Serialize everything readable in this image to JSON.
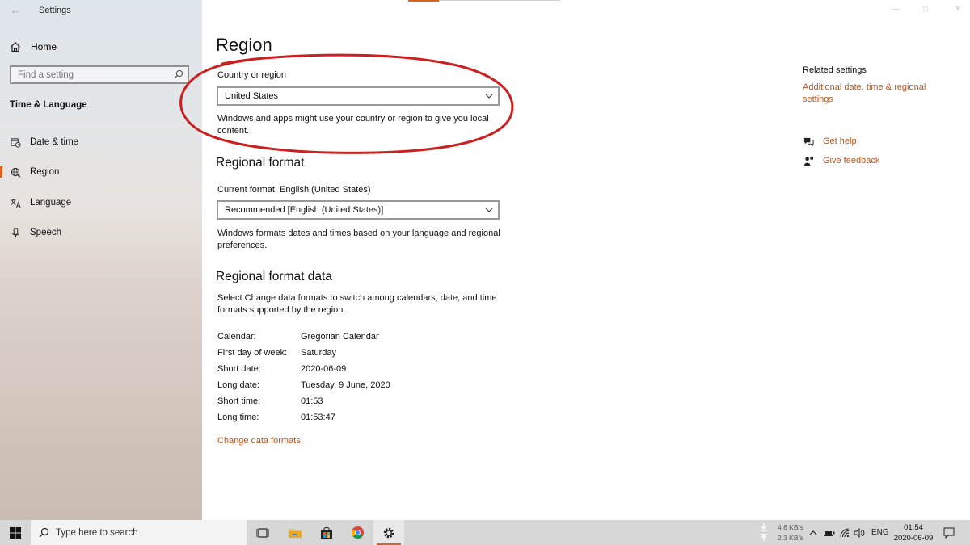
{
  "window": {
    "title": "Settings"
  },
  "sidebar": {
    "home_label": "Home",
    "search_placeholder": "Find a setting",
    "section_title": "Time & Language",
    "items": [
      {
        "label": "Date & time",
        "icon": "calendar-clock-icon",
        "active": false
      },
      {
        "label": "Region",
        "icon": "globe-icon",
        "active": true
      },
      {
        "label": "Language",
        "icon": "language-icon",
        "active": false
      },
      {
        "label": "Speech",
        "icon": "microphone-icon",
        "active": false
      }
    ]
  },
  "page": {
    "title": "Region",
    "country": {
      "label": "Country or region",
      "value": "United States",
      "description": "Windows and apps might use your country or region to give you local content."
    },
    "regional_format": {
      "heading": "Regional format",
      "current_label": "Current format: English (United States)",
      "value": "Recommended [English (United States)]",
      "description": "Windows formats dates and times based on your language and regional preferences."
    },
    "format_data": {
      "heading": "Regional format data",
      "description": "Select Change data formats to switch among calendars, date, and time formats supported by the region.",
      "rows": [
        {
          "key": "Calendar:",
          "value": "Gregorian Calendar"
        },
        {
          "key": "First day of week:",
          "value": "Saturday"
        },
        {
          "key": "Short date:",
          "value": "2020-06-09"
        },
        {
          "key": "Long date:",
          "value": "Tuesday, 9 June, 2020"
        },
        {
          "key": "Short time:",
          "value": "01:53"
        },
        {
          "key": "Long time:",
          "value": "01:53:47"
        }
      ],
      "change_link": "Change data formats"
    }
  },
  "related": {
    "title": "Related settings",
    "link": "Additional date, time & regional settings",
    "help": "Get help",
    "feedback": "Give feedback"
  },
  "taskbar": {
    "search_placeholder": "Type here to search",
    "net_down": "4.6 KB/s",
    "net_up": "2.3 KB/s",
    "language": "ENG",
    "time": "01:54",
    "date": "2020-06-09"
  },
  "colors": {
    "accent": "#d9621f",
    "link": "#b8541c",
    "annotation": "#cc1f1f"
  }
}
